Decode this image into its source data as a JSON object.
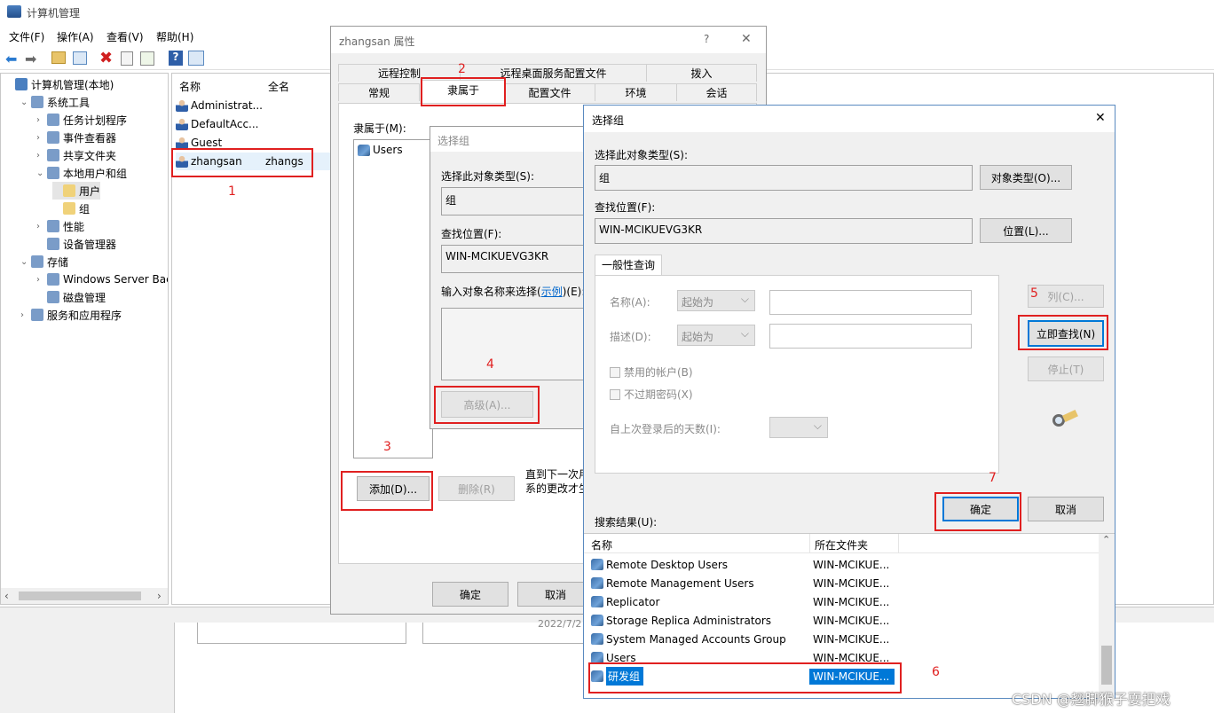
{
  "main_window": {
    "title": "计算机管理",
    "menu": [
      "文件(F)",
      "操作(A)",
      "查看(V)",
      "帮助(H)"
    ],
    "tree": [
      {
        "label": "计算机管理(本地)",
        "level": 0,
        "arrow": ""
      },
      {
        "label": "系统工具",
        "level": 1,
        "arrow": "⌄"
      },
      {
        "label": "任务计划程序",
        "level": 2,
        "arrow": "›"
      },
      {
        "label": "事件查看器",
        "level": 2,
        "arrow": "›"
      },
      {
        "label": "共享文件夹",
        "level": 2,
        "arrow": "›"
      },
      {
        "label": "本地用户和组",
        "level": 2,
        "arrow": "⌄"
      },
      {
        "label": "用户",
        "level": 3,
        "arrow": ""
      },
      {
        "label": "组",
        "level": 3,
        "arrow": ""
      },
      {
        "label": "性能",
        "level": 2,
        "arrow": "›"
      },
      {
        "label": "设备管理器",
        "level": 2,
        "arrow": ""
      },
      {
        "label": "存储",
        "level": 1,
        "arrow": "⌄"
      },
      {
        "label": "Windows Server Back",
        "level": 2,
        "arrow": "›"
      },
      {
        "label": "磁盘管理",
        "level": 2,
        "arrow": ""
      },
      {
        "label": "服务和应用程序",
        "level": 1,
        "arrow": "›"
      }
    ],
    "list_headers": [
      "名称",
      "全名"
    ],
    "users": [
      {
        "name": "Administrat...",
        "fullname": ""
      },
      {
        "name": "DefaultAcc...",
        "fullname": ""
      },
      {
        "name": "Guest",
        "fullname": ""
      },
      {
        "name": "zhangsan",
        "fullname": "zhangs"
      }
    ],
    "bottom_fragment": "2022/7/2"
  },
  "props_dialog": {
    "title": "zhangsan 属性",
    "help": "?",
    "close": "✕",
    "tabs_row1": [
      "远程控制",
      "远程桌面服务配置文件",
      "拨入"
    ],
    "tabs_row2": [
      "常规",
      "隶属于",
      "配置文件",
      "环境",
      "会话"
    ],
    "member_of_label": "隶属于(M):",
    "member_of_items": [
      "Users"
    ],
    "add_button": "添加(D)...",
    "remove_button": "删除(R)",
    "note_line1": "直到下一次用",
    "note_line2": "系的更改才生",
    "ok_button": "确定",
    "cancel_button": "取消"
  },
  "select_group_small": {
    "title": "选择组",
    "object_type_label": "选择此对象类型(S):",
    "object_type_value": "组",
    "location_label": "查找位置(F):",
    "location_value": "WIN-MCIKUEVG3KR",
    "enter_names_label": "输入对象名称来选择(",
    "examples_link": "示例",
    "enter_names_suffix": ")(E):",
    "advanced_button": "高级(A)..."
  },
  "select_group_adv": {
    "title": "选择组",
    "close": "✕",
    "object_type_label": "选择此对象类型(S):",
    "object_type_value": "组",
    "object_types_button": "对象类型(O)...",
    "location_label": "查找位置(F):",
    "location_value": "WIN-MCIKUEVG3KR",
    "locations_button": "位置(L)...",
    "common_queries_tab": "一般性查询",
    "name_label": "名称(A):",
    "name_combo": "起始为",
    "desc_label": "描述(D):",
    "desc_combo": "起始为",
    "disabled_accounts": "禁用的帐户(B)",
    "non_expiring": "不过期密码(X)",
    "days_since_logon": "自上次登录后的天数(I):",
    "columns_button": "列(C)...",
    "find_now_button": "立即查找(N)",
    "stop_button": "停止(T)",
    "ok_button": "确定",
    "cancel_button": "取消",
    "results_label": "搜索结果(U):",
    "results_headers": [
      "名称",
      "所在文件夹"
    ],
    "results": [
      {
        "name": "Remote Desktop Users",
        "folder": "WIN-MCIKUE..."
      },
      {
        "name": "Remote Management Users",
        "folder": "WIN-MCIKUE..."
      },
      {
        "name": "Replicator",
        "folder": "WIN-MCIKUE..."
      },
      {
        "name": "Storage Replica Administrators",
        "folder": "WIN-MCIKUE..."
      },
      {
        "name": "System Managed Accounts Group",
        "folder": "WIN-MCIKUE..."
      },
      {
        "name": "Users",
        "folder": "WIN-MCIKUE..."
      },
      {
        "name": "研发组",
        "folder": "WIN-MCIKUE..."
      }
    ]
  },
  "annotations": [
    "1",
    "2",
    "3",
    "4",
    "5",
    "6",
    "7"
  ],
  "watermark": "CSDN @翘脚猴子耍把戏",
  "colors": {
    "accent": "#0078d7",
    "highlight_red": "#e02020",
    "selection": "#0078d7"
  }
}
